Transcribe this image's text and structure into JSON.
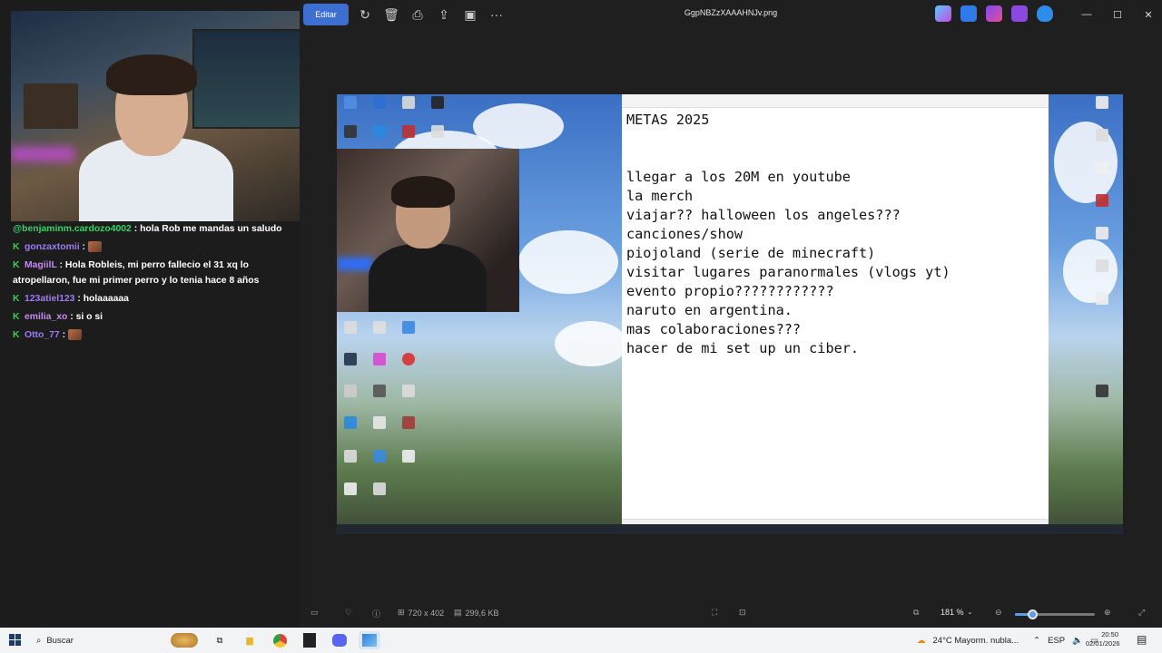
{
  "viewer": {
    "edit_label": "Editar",
    "filename": "GgpNBZzXAAAHNJv.png",
    "image_dimensions": "720 x 402",
    "file_size": "299,6 KB",
    "zoom": "181 %",
    "zoom_fraction": 0.22
  },
  "notepad": {
    "lines": [
      "METAS 2025",
      "",
      "",
      "llegar a los 20M en youtube",
      "la merch",
      "viajar?? halloween los angeles???",
      "canciones/show",
      "piojoland (serie de minecraft)",
      "visitar lugares paranormales (vlogs yt)",
      "evento propio????????????",
      "naruto en argentina.",
      "mas colaboraciones???",
      "hacer de mi set up un ciber."
    ]
  },
  "chat": {
    "messages": [
      {
        "user": "@benjaminm.cardozo4002",
        "color": "#35d46a",
        "badge": "",
        "text": "hola Rob me mandas un saludo",
        "emote": false
      },
      {
        "user": "gonzaxtomii",
        "color": "#9b7cf0",
        "badge": "K",
        "text": "",
        "emote": true
      },
      {
        "user": "MagiilL",
        "color": "#c08cf0",
        "badge": "K",
        "text": "Hola Robleis, mi perro fallecio el 31 xq lo atropellaron, fue mi primer perro y lo tenia hace 8 años",
        "emote": false
      },
      {
        "user": "123atiel123",
        "color": "#9b7cf0",
        "badge": "K",
        "text": "holaaaaaa",
        "emote": false
      },
      {
        "user": "emilia_xo",
        "color": "#c08cf0",
        "badge": "K",
        "text": "si o si",
        "emote": false
      },
      {
        "user": "Otto_77",
        "color": "#9b7cf0",
        "badge": "K",
        "text": "",
        "emote": true
      }
    ]
  },
  "taskbar": {
    "search_placeholder": "Buscar",
    "weather": "24°C  Mayorm. nubla...",
    "language": "ESP",
    "time": "20:50",
    "date": "02/01/2026"
  }
}
